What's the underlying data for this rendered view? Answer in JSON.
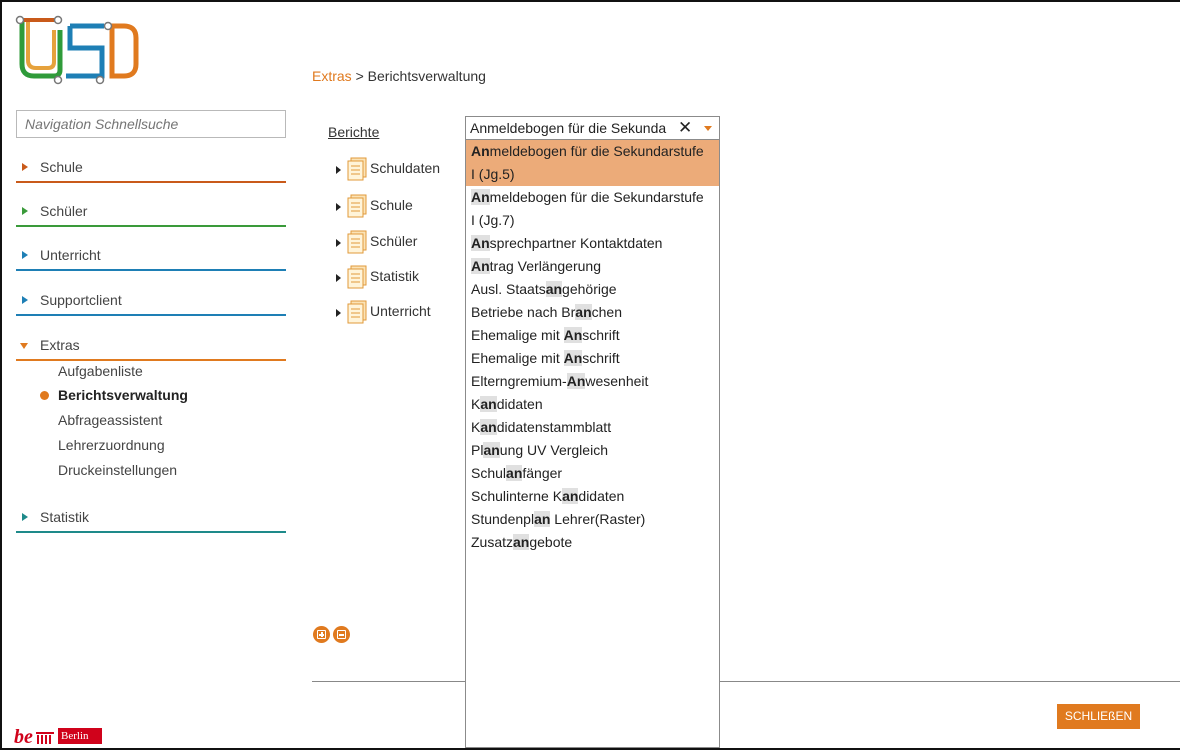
{
  "nav": {
    "search_placeholder": "Navigation Schnellsuche",
    "items": [
      {
        "label": "Schule",
        "color": "#c95a1a"
      },
      {
        "label": "Schüler",
        "color": "#3a9a3a"
      },
      {
        "label": "Unterricht",
        "color": "#1e7fb5"
      },
      {
        "label": "Supportclient",
        "color": "#1e7fb5"
      },
      {
        "label": "Extras",
        "color": "#e07a1f"
      },
      {
        "label": "Statistik",
        "color": "#1e8a8a"
      }
    ],
    "extras_sub": [
      "Aufgabenliste",
      "Berichtsverwaltung",
      "Abfrageassistent",
      "Lehrerzuordnung",
      "Druckeinstellungen"
    ]
  },
  "breadcrumb": {
    "link": "Extras",
    "separator": " > ",
    "current": "Berichtsverwaltung"
  },
  "reports_label": "Berichte",
  "tree": [
    "Schuldaten",
    "Schule",
    "Schüler",
    "Statistik",
    "Unterricht"
  ],
  "combo": {
    "value": "Anmeldebogen für die Sekunda",
    "clear_icon": "✕"
  },
  "dropdown": [
    {
      "pre": "",
      "hl": "An",
      "post": "meldebogen für die Sekundarstufe",
      "line2": "I (Jg.5)",
      "selected": true
    },
    {
      "pre": "",
      "hl": "An",
      "post": "meldebogen für die Sekundarstufe",
      "line2": "I (Jg.7)"
    },
    {
      "pre": "",
      "hl": "An",
      "post": "sprechpartner Kontaktdaten"
    },
    {
      "pre": "",
      "hl": "An",
      "post": "trag Verlängerung"
    },
    {
      "pre": "Ausl. Staats",
      "hl": "an",
      "post": "gehörige"
    },
    {
      "pre": "Betriebe nach Br",
      "hl": "an",
      "post": "chen"
    },
    {
      "pre": "Ehemalige mit ",
      "hl": "An",
      "post": "schrift"
    },
    {
      "pre": "Ehemalige mit ",
      "hl": "An",
      "post": "schrift"
    },
    {
      "pre": "Elterngremium-",
      "hl": "An",
      "post": "wesenheit"
    },
    {
      "pre": "K",
      "hl": "an",
      "post": "didaten"
    },
    {
      "pre": "K",
      "hl": "an",
      "post": "didatenstammblatt"
    },
    {
      "pre": "Pl",
      "hl": "an",
      "post": "ung UV Vergleich"
    },
    {
      "pre": "Schul",
      "hl": "an",
      "post": "fänger"
    },
    {
      "pre": "Schulinterne K",
      "hl": "an",
      "post": "didaten"
    },
    {
      "pre": "Stundenpl",
      "hl": "an",
      "post": " Lehrer(Raster)"
    },
    {
      "pre": "Zusatz",
      "hl": "an",
      "post": "gebote"
    }
  ],
  "buttons": {
    "close": "SCHLIEßEN"
  },
  "footer": {
    "berlin_label": "Berlin"
  },
  "colors": {
    "accent": "#e07a1f",
    "selected": "#ecab79"
  }
}
